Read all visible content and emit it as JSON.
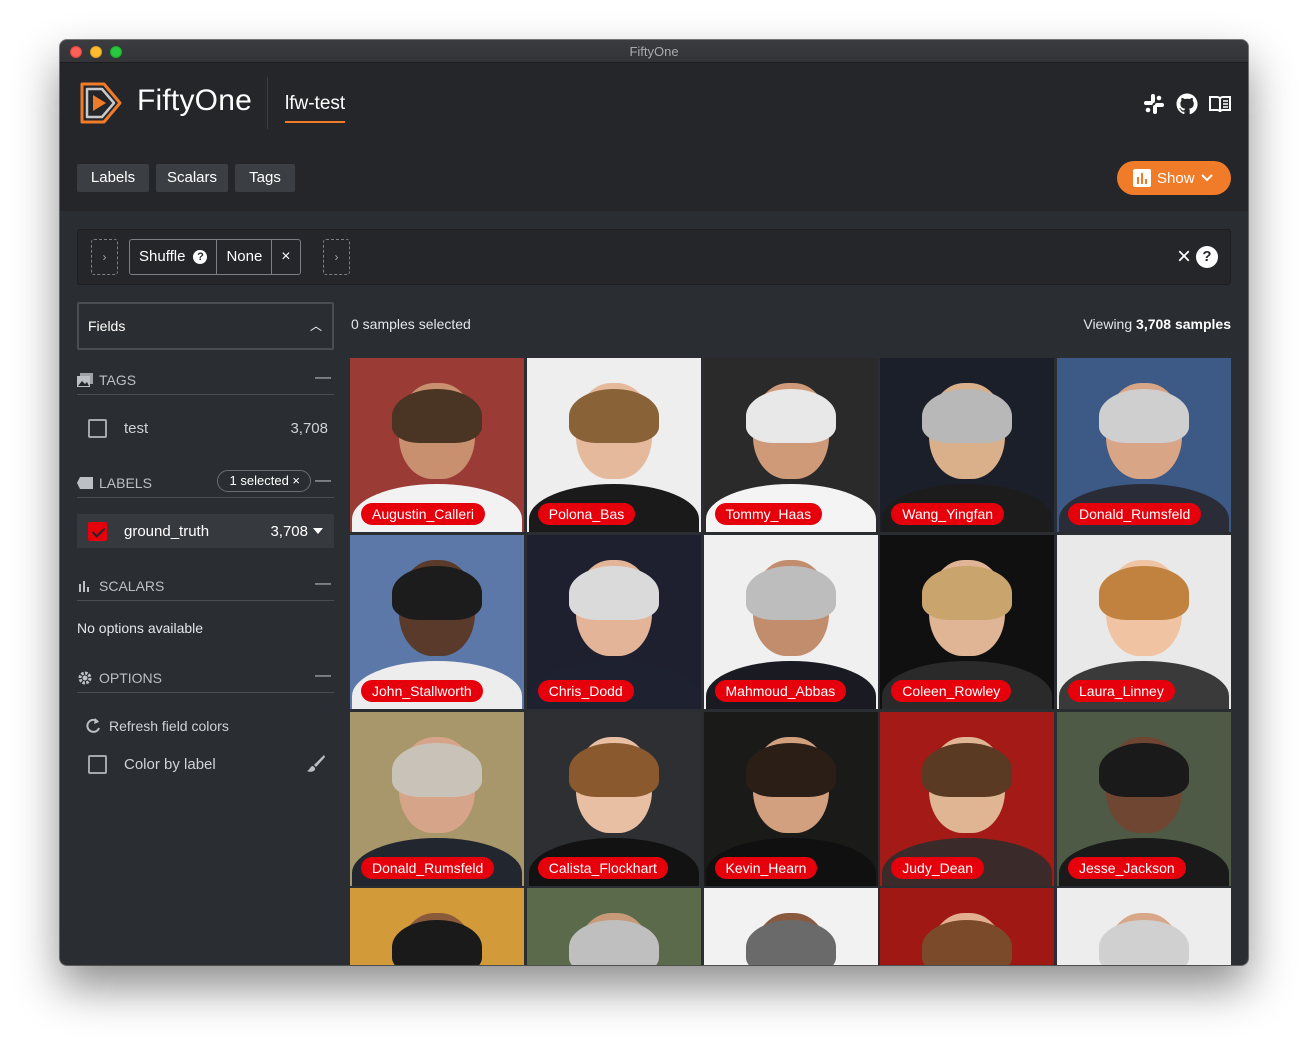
{
  "window": {
    "title": "FiftyOne"
  },
  "header": {
    "brand": "FiftyOne",
    "dataset": "lfw-test",
    "icons": [
      "slack-icon",
      "github-icon",
      "docs-book-icon"
    ]
  },
  "toolbar": {
    "tabs": [
      "Labels",
      "Scalars",
      "Tags"
    ],
    "show_label": "Show",
    "accent_color": "#f07c2a"
  },
  "view_bar": {
    "stage_name": "Shuffle",
    "stage_param": "None",
    "close_glyph": "×",
    "help_glyph": "?"
  },
  "sidebar": {
    "fields_label": "Fields",
    "tags": {
      "heading": "TAGS",
      "items": [
        {
          "label": "test",
          "count": "3,708",
          "checked": false
        }
      ]
    },
    "labels": {
      "heading": "LABELS",
      "selected_pill": "1 selected ×",
      "items": [
        {
          "label": "ground_truth",
          "count": "3,708",
          "checked": true,
          "color": "#e6000b"
        }
      ]
    },
    "scalars": {
      "heading": "SCALARS",
      "empty_text": "No options available"
    },
    "options": {
      "heading": "OPTIONS",
      "refresh_label": "Refresh field colors",
      "color_by_label": "Color by label"
    }
  },
  "status": {
    "selected_text": "0 samples selected",
    "viewing_prefix": "Viewing ",
    "viewing_count": "3,708 samples"
  },
  "grid": {
    "label_color": "#e6000b",
    "samples": [
      {
        "label": "Augustin_Calleri"
      },
      {
        "label": "Polona_Bas"
      },
      {
        "label": "Tommy_Haas"
      },
      {
        "label": "Wang_Yingfan"
      },
      {
        "label": "Donald_Rumsfeld"
      },
      {
        "label": "John_Stallworth"
      },
      {
        "label": "Chris_Dodd"
      },
      {
        "label": "Mahmoud_Abbas"
      },
      {
        "label": "Coleen_Rowley"
      },
      {
        "label": "Laura_Linney"
      },
      {
        "label": "Donald_Rumsfeld"
      },
      {
        "label": "Calista_Flockhart"
      },
      {
        "label": "Kevin_Hearn"
      },
      {
        "label": "Judy_Dean"
      },
      {
        "label": "Jesse_Jackson"
      },
      {
        "label": ""
      },
      {
        "label": ""
      },
      {
        "label": ""
      },
      {
        "label": ""
      },
      {
        "label": ""
      }
    ]
  }
}
